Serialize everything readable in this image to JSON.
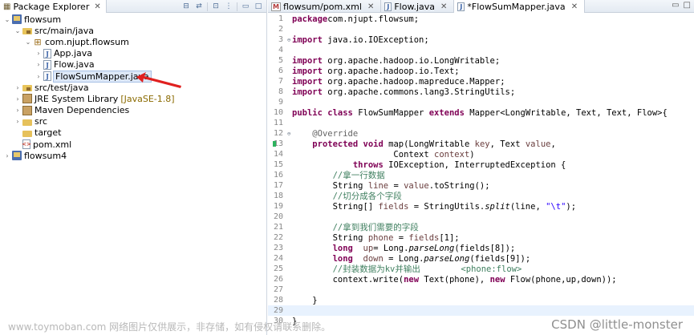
{
  "explorer": {
    "tab_label": "Package Explorer",
    "tree": [
      {
        "label": "flowsum",
        "depth": 0,
        "twisty": "open",
        "icon": "project-icon"
      },
      {
        "label": "src/main/java",
        "depth": 1,
        "twisty": "open",
        "icon": "source-folder-icon"
      },
      {
        "label": "com.njupt.flowsum",
        "depth": 2,
        "twisty": "open",
        "icon": "package-icon"
      },
      {
        "label": "App.java",
        "depth": 3,
        "twisty": "closed",
        "icon": "java-file-icon"
      },
      {
        "label": "Flow.java",
        "depth": 3,
        "twisty": "closed",
        "icon": "java-file-icon"
      },
      {
        "label": "FlowSumMapper.java",
        "depth": 3,
        "twisty": "closed",
        "icon": "java-file-icon",
        "selected": true
      },
      {
        "label": "src/test/java",
        "depth": 1,
        "twisty": "closed",
        "icon": "source-folder-icon"
      },
      {
        "label": "JRE System Library",
        "decoration": "[JavaSE-1.8]",
        "depth": 1,
        "twisty": "closed",
        "icon": "library-icon"
      },
      {
        "label": "Maven Dependencies",
        "depth": 1,
        "twisty": "closed",
        "icon": "library-icon"
      },
      {
        "label": "src",
        "depth": 1,
        "twisty": "closed",
        "icon": "folder-icon"
      },
      {
        "label": "target",
        "depth": 1,
        "twisty": "none",
        "icon": "folder-icon"
      },
      {
        "label": "pom.xml",
        "depth": 1,
        "twisty": "none",
        "icon": "xml-file-icon"
      },
      {
        "label": "flowsum4",
        "depth": 0,
        "twisty": "closed",
        "icon": "project-icon"
      }
    ]
  },
  "editor": {
    "tabs": [
      {
        "label": "flowsum/pom.xml",
        "icon": "maven-pom-icon",
        "active": false
      },
      {
        "label": "Flow.java",
        "icon": "java-file-icon",
        "active": false
      },
      {
        "label": "*FlowSumMapper.java",
        "icon": "java-file-icon",
        "active": true
      }
    ],
    "lines": [
      {
        "n": "1",
        "seg": [
          [
            "kw",
            "package"
          ],
          [
            "",
            "com.njupt.flowsum;"
          ]
        ]
      },
      {
        "n": "2",
        "seg": []
      },
      {
        "n": "3",
        "fold": "⊖",
        "seg": [
          [
            "kw",
            "import"
          ],
          [
            "",
            " java.io.IOException;"
          ]
        ]
      },
      {
        "n": "4",
        "seg": []
      },
      {
        "n": "5",
        "seg": [
          [
            "kw",
            "import"
          ],
          [
            "",
            " org.apache.hadoop.io.LongWritable;"
          ]
        ]
      },
      {
        "n": "6",
        "seg": [
          [
            "kw",
            "import"
          ],
          [
            "",
            " org.apache.hadoop.io.Text;"
          ]
        ]
      },
      {
        "n": "7",
        "seg": [
          [
            "kw",
            "import"
          ],
          [
            "",
            " org.apache.hadoop.mapreduce.Mapper;"
          ]
        ]
      },
      {
        "n": "8",
        "seg": [
          [
            "kw",
            "import"
          ],
          [
            "",
            " org.apache.commons.lang3.StringUtils;"
          ]
        ]
      },
      {
        "n": "9",
        "seg": []
      },
      {
        "n": "10",
        "seg": [
          [
            "kw",
            "public"
          ],
          [
            "",
            " "
          ],
          [
            "kw",
            "class"
          ],
          [
            "",
            " FlowSumMapper "
          ],
          [
            "kw",
            "extends"
          ],
          [
            "",
            " Mapper<LongWritable, Text, Text, Flow>{"
          ]
        ]
      },
      {
        "n": "11",
        "seg": []
      },
      {
        "n": "12",
        "fold": "⊖",
        "seg": [
          [
            "",
            "    "
          ],
          [
            "ann",
            "@Override"
          ]
        ]
      },
      {
        "n": "13",
        "marker": true,
        "seg": [
          [
            "",
            "    "
          ],
          [
            "kw",
            "protected"
          ],
          [
            "",
            " "
          ],
          [
            "kw",
            "void"
          ],
          [
            "",
            " map(LongWritable "
          ],
          [
            "var",
            "key"
          ],
          [
            "",
            ", Text "
          ],
          [
            "var",
            "value"
          ],
          [
            ",",
            ","
          ]
        ]
      },
      {
        "n": "14",
        "seg": [
          [
            "",
            "                    Context "
          ],
          [
            "var",
            "context"
          ],
          [
            "",
            ")"
          ]
        ]
      },
      {
        "n": "15",
        "seg": [
          [
            "",
            "            "
          ],
          [
            "kw",
            "throws"
          ],
          [
            "",
            " IOException, InterruptedException {"
          ]
        ]
      },
      {
        "n": "16",
        "seg": [
          [
            "",
            "        "
          ],
          [
            "cm",
            "//拿一行数据"
          ]
        ]
      },
      {
        "n": "17",
        "seg": [
          [
            "",
            "        String "
          ],
          [
            "var",
            "line"
          ],
          [
            "",
            " = "
          ],
          [
            "var",
            "value"
          ],
          [
            "",
            ".toString();"
          ]
        ]
      },
      {
        "n": "18",
        "seg": [
          [
            "",
            "        "
          ],
          [
            "cm",
            "//切分成各个字段"
          ]
        ]
      },
      {
        "n": "19",
        "seg": [
          [
            "",
            "        String[] "
          ],
          [
            "var",
            "fields"
          ],
          [
            "",
            " = StringUtils."
          ],
          [
            "it",
            "split"
          ],
          [
            "",
            "(line, "
          ],
          [
            "str",
            "\"\\t\""
          ],
          [
            "",
            ");"
          ]
        ]
      },
      {
        "n": "20",
        "seg": []
      },
      {
        "n": "21",
        "seg": [
          [
            "",
            "        "
          ],
          [
            "cm",
            "//拿到我们需要的字段"
          ]
        ]
      },
      {
        "n": "22",
        "seg": [
          [
            "",
            "        String "
          ],
          [
            "var",
            "phone"
          ],
          [
            "",
            " = "
          ],
          [
            "var",
            "fields"
          ],
          [
            "",
            "[1];"
          ]
        ]
      },
      {
        "n": "23",
        "seg": [
          [
            "",
            "        "
          ],
          [
            "kw",
            "long"
          ],
          [
            "",
            "  "
          ],
          [
            "var",
            "up"
          ],
          [
            "",
            "= Long."
          ],
          [
            "it",
            "parseLong"
          ],
          [
            "",
            "(fields[8]);"
          ]
        ]
      },
      {
        "n": "24",
        "seg": [
          [
            "",
            "        "
          ],
          [
            "kw",
            "long"
          ],
          [
            "",
            "  "
          ],
          [
            "var",
            "down"
          ],
          [
            "",
            " = Long."
          ],
          [
            "it",
            "parseLong"
          ],
          [
            "",
            "(fields[9]);"
          ]
        ]
      },
      {
        "n": "25",
        "seg": [
          [
            "",
            "        "
          ],
          [
            "cm",
            "//封装数据为kv并输出        <phone:flow>"
          ]
        ]
      },
      {
        "n": "26",
        "seg": [
          [
            "",
            "        context.write("
          ],
          [
            "kw",
            "new"
          ],
          [
            "",
            " Text(phone), "
          ],
          [
            "kw",
            "new"
          ],
          [
            "",
            " Flow(phone,up,down));"
          ]
        ]
      },
      {
        "n": "27",
        "seg": []
      },
      {
        "n": "28",
        "seg": [
          [
            "",
            "    }"
          ]
        ]
      },
      {
        "n": "29",
        "current": true,
        "seg": []
      },
      {
        "n": "30",
        "seg": [
          [
            "",
            "}"
          ]
        ]
      }
    ]
  },
  "watermarks": {
    "left": "www.toymoban.com 网络图片仅供展示，非存储，如有侵权请联系删除。",
    "right": "CSDN @little-monster"
  }
}
